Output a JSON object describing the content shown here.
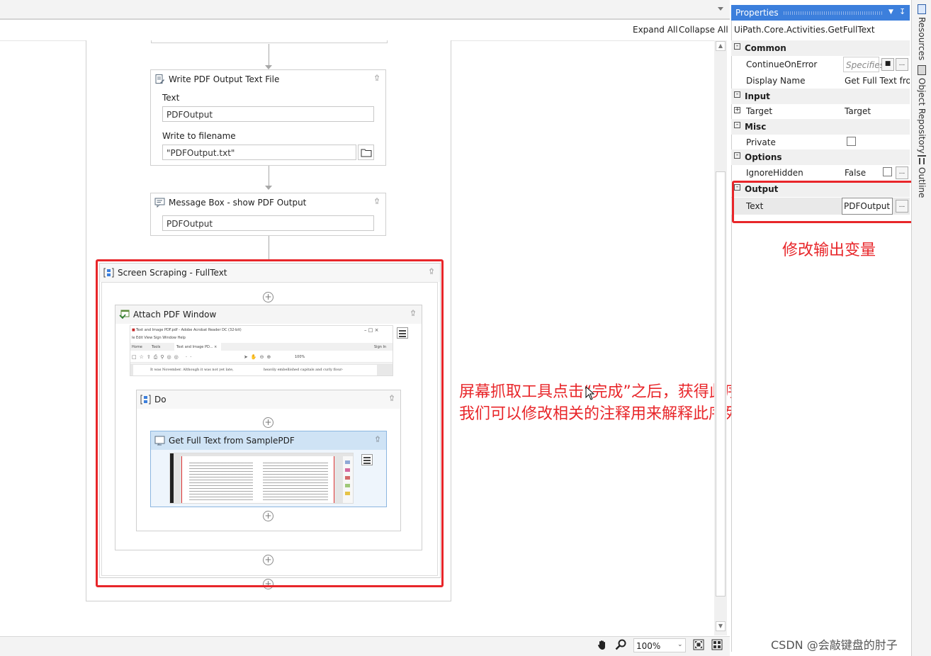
{
  "toolbar": {
    "expand_all": "Expand All",
    "collapse_all": "Collapse All"
  },
  "workflow": {
    "write_pdf": {
      "title": "Write PDF Output Text File",
      "text_label": "Text",
      "text_value": "PDFOutput",
      "filename_label": "Write to filename",
      "filename_value": "\"PDFOutput.txt\""
    },
    "message_box": {
      "title": "Message Box - show PDF Output",
      "value": "PDFOutput"
    },
    "screen_scraping": {
      "title": "Screen Scraping - FullText"
    },
    "attach_pdf": {
      "title": "Attach PDF Window",
      "thumb": {
        "window_title": "Text and Image PDF.pdf - Adobe Acrobat Reader DC (32-bit)",
        "menu": "le  Edit  View  Sign  Window  Help",
        "tab_home": "Home",
        "tab_tools": "Tools",
        "tab_doc": "Text and Image PD...  ×",
        "sign_in": "Sign In",
        "zoom": "100%",
        "body_left": "It was November. Although it was not yet late,",
        "body_right": "heavily embellished capitals and curly flour-"
      }
    },
    "do": {
      "title": "Do"
    },
    "get_full_text": {
      "title": "Get Full Text from SamplePDF"
    }
  },
  "annotations": {
    "props_note": "修改输出变量",
    "canvas_note_line1": "屏幕抓取工具点击“完成”之后，获得此序列，",
    "canvas_note_line2": "我们可以修改相关的注释用来解释此序列的作用。"
  },
  "bottom": {
    "zoom": "100%",
    "watermark": "CSDN @会敲键盘的肘子"
  },
  "properties": {
    "header": "Properties",
    "activity_type": "UiPath.Core.Activities.GetFullText",
    "categories": {
      "common": "Common",
      "input": "Input",
      "misc": "Misc",
      "options": "Options",
      "output": "Output"
    },
    "rows": {
      "continue_on_error": {
        "name": "ContinueOnError",
        "value": "Specifies"
      },
      "display_name": {
        "name": "Display Name",
        "value": "Get Full Text from"
      },
      "target": {
        "name": "Target",
        "value": "Target"
      },
      "private": {
        "name": "Private"
      },
      "ignore_hidden": {
        "name": "IgnoreHidden",
        "value": "False"
      },
      "text": {
        "name": "Text",
        "value": "PDFOutput"
      }
    }
  },
  "rail": {
    "resources": "Resources",
    "object_repository": "Object Repository",
    "outline": "Outline"
  },
  "colors": {
    "accent": "#3c7fdc",
    "annotation_red": "#e8262a",
    "selected_activity": "#cfe3f5"
  }
}
